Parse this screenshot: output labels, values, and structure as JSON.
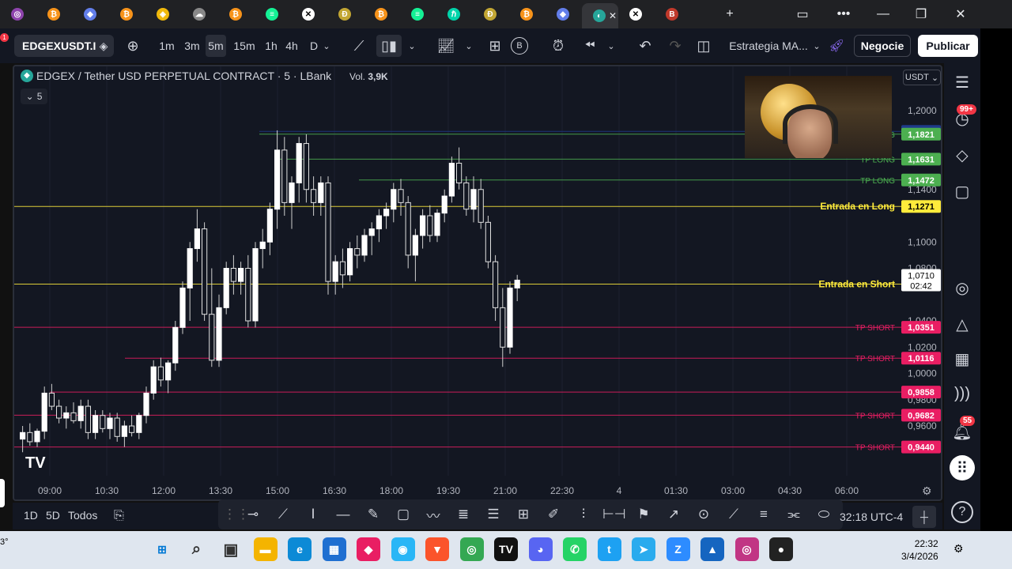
{
  "browser": {
    "tabs": [
      {
        "icon": "circle-icon",
        "color": "#8e44ad",
        "glyph": "◎"
      },
      {
        "icon": "bitcoin-icon",
        "color": "#f7931a",
        "glyph": "₿"
      },
      {
        "icon": "ethereum-icon",
        "color": "#627eea",
        "glyph": "◆"
      },
      {
        "icon": "bitcoin-icon",
        "color": "#f7931a",
        "glyph": "₿"
      },
      {
        "icon": "shield-coin-icon",
        "color": "#f0b90b",
        "glyph": "◈"
      },
      {
        "icon": "cloud-icon",
        "color": "#888888",
        "glyph": "☁"
      },
      {
        "icon": "bitcoin-icon",
        "color": "#f7931a",
        "glyph": "₿"
      },
      {
        "icon": "solana-icon",
        "color": "#14f195",
        "glyph": "≡"
      },
      {
        "icon": "x-icon",
        "color": "#ffffff",
        "glyph": "✕"
      },
      {
        "icon": "dogecoin-icon",
        "color": "#c2a633",
        "glyph": "Ð"
      },
      {
        "icon": "bitcoin-icon",
        "color": "#f7931a",
        "glyph": "₿"
      },
      {
        "icon": "solana-icon",
        "color": "#14f195",
        "glyph": "≡"
      },
      {
        "icon": "hbar-icon",
        "color": "#00d4aa",
        "glyph": "ℏ"
      },
      {
        "icon": "dogecoin-icon",
        "color": "#c2a633",
        "glyph": "Ð"
      },
      {
        "icon": "bitcoin-icon",
        "color": "#f7931a",
        "glyph": "₿"
      },
      {
        "icon": "ethereum-icon",
        "color": "#627eea",
        "glyph": "◆"
      },
      {
        "icon": "tradingview-icon",
        "color": "#26a69a",
        "glyph": "◐",
        "active": true
      },
      {
        "icon": "x-logo-icon",
        "color": "#ffffff",
        "glyph": "✕"
      },
      {
        "icon": "red-app-icon",
        "color": "#c0392b",
        "glyph": "B"
      }
    ]
  },
  "toolbar": {
    "symbol": "EDGEXUSDT.I",
    "intervals": [
      "1m",
      "3m",
      "5m",
      "15m",
      "1h",
      "4h",
      "D"
    ],
    "selected_interval": "5m",
    "strategy": "Estrategia MA...",
    "negocie": "Negocie",
    "publicar": "Publicar",
    "notif_count": "1"
  },
  "legend": {
    "title": "EDGEX / Tether USD PERPETUAL CONTRACT · 5 · LBank",
    "vol_label": "Vol.",
    "vol_value": "3,9K",
    "collapse_count": "5",
    "currency": "USDT"
  },
  "chart_data": {
    "type": "candlestick",
    "price_axis": [
      "1,2000",
      "1,1400",
      "1,1000",
      "1,0800",
      "1,0400",
      "1,0200",
      "1,0000",
      "0,9800",
      "0,9600"
    ],
    "time_axis": [
      "09:00",
      "10:30",
      "12:00",
      "13:30",
      "15:00",
      "16:30",
      "18:00",
      "19:30",
      "21:00",
      "22:30",
      "4",
      "01:30",
      "03:00",
      "04:30",
      "06:00"
    ],
    "levels": [
      {
        "label": "",
        "price": "1,1842",
        "color": "#1e3a8a"
      },
      {
        "label": "TP LONG",
        "price": "1,1821",
        "color": "#4caf50"
      },
      {
        "label": "TP LONG",
        "price": "1,1631",
        "color": "#4caf50"
      },
      {
        "label": "TP LONG",
        "price": "1,1472",
        "color": "#4caf50"
      },
      {
        "label": "Entrada en Long",
        "price": "1,1271",
        "color": "#ffeb3b"
      },
      {
        "label": "Entrada en Short",
        "price": "1,0680",
        "color": "#ffeb3b"
      },
      {
        "label": "TP SHORT",
        "price": "1,0351",
        "color": "#e91e63"
      },
      {
        "label": "TP SHORT",
        "price": "1,0116",
        "color": "#e91e63"
      },
      {
        "label": "",
        "price": "0,9858",
        "color": "#e91e63"
      },
      {
        "label": "TP SHORT",
        "price": "0,9682",
        "color": "#e91e63"
      },
      {
        "label": "TP SHORT",
        "price": "0,9440",
        "color": "#e91e63"
      }
    ],
    "current_price": "1,0710",
    "countdown": "02:42",
    "candles": [
      [
        0.95,
        0.96,
        0.94,
        0.955
      ],
      [
        0.955,
        0.962,
        0.945,
        0.948
      ],
      [
        0.948,
        0.958,
        0.944,
        0.956
      ],
      [
        0.956,
        0.99,
        0.95,
        0.985
      ],
      [
        0.985,
        0.992,
        0.972,
        0.975
      ],
      [
        0.975,
        0.98,
        0.962,
        0.966
      ],
      [
        0.966,
        0.975,
        0.958,
        0.97
      ],
      [
        0.97,
        0.978,
        0.962,
        0.964
      ],
      [
        0.964,
        0.98,
        0.958,
        0.975
      ],
      [
        0.975,
        0.98,
        0.95,
        0.955
      ],
      [
        0.955,
        0.972,
        0.95,
        0.968
      ],
      [
        0.968,
        0.972,
        0.955,
        0.958
      ],
      [
        0.958,
        0.97,
        0.95,
        0.966
      ],
      [
        0.966,
        0.97,
        0.948,
        0.952
      ],
      [
        0.952,
        0.964,
        0.944,
        0.96
      ],
      [
        0.96,
        0.968,
        0.952,
        0.955
      ],
      [
        0.955,
        0.97,
        0.95,
        0.968
      ],
      [
        0.968,
        0.99,
        0.962,
        0.985
      ],
      [
        0.985,
        1.01,
        0.98,
        1.005
      ],
      [
        1.005,
        1.012,
        0.99,
        0.995
      ],
      [
        0.995,
        1.01,
        0.985,
        1.008
      ],
      [
        1.008,
        1.04,
        1.002,
        1.035
      ],
      [
        1.035,
        1.07,
        1.03,
        1.065
      ],
      [
        1.065,
        1.1,
        1.04,
        1.095
      ],
      [
        1.095,
        1.125,
        1.085,
        1.11
      ],
      [
        1.11,
        1.115,
        1.04,
        1.045
      ],
      [
        1.045,
        1.08,
        1.005,
        1.01
      ],
      [
        1.01,
        1.06,
        1.005,
        1.05
      ],
      [
        1.05,
        1.085,
        1.045,
        1.08
      ],
      [
        1.08,
        1.09,
        1.06,
        1.07
      ],
      [
        1.07,
        1.085,
        1.06,
        1.08
      ],
      [
        1.08,
        1.09,
        1.035,
        1.04
      ],
      [
        1.04,
        1.1,
        1.035,
        1.095
      ],
      [
        1.095,
        1.11,
        1.08,
        1.1
      ],
      [
        1.1,
        1.13,
        1.09,
        1.125
      ],
      [
        1.125,
        1.185,
        1.11,
        1.17
      ],
      [
        1.17,
        1.18,
        1.12,
        1.13
      ],
      [
        1.13,
        1.15,
        1.11,
        1.145
      ],
      [
        1.145,
        1.18,
        1.13,
        1.175
      ],
      [
        1.175,
        1.182,
        1.13,
        1.14
      ],
      [
        1.14,
        1.15,
        1.12,
        1.13
      ],
      [
        1.13,
        1.15,
        1.12,
        1.145
      ],
      [
        1.145,
        1.15,
        1.06,
        1.07
      ],
      [
        1.07,
        1.09,
        1.06,
        1.085
      ],
      [
        1.085,
        1.095,
        1.065,
        1.075
      ],
      [
        1.075,
        1.1,
        1.07,
        1.095
      ],
      [
        1.095,
        1.105,
        1.08,
        1.09
      ],
      [
        1.09,
        1.11,
        1.085,
        1.105
      ],
      [
        1.105,
        1.115,
        1.09,
        1.11
      ],
      [
        1.11,
        1.125,
        1.1,
        1.12
      ],
      [
        1.12,
        1.13,
        1.11,
        1.125
      ],
      [
        1.125,
        1.145,
        1.115,
        1.14
      ],
      [
        1.14,
        1.148,
        1.12,
        1.13
      ],
      [
        1.13,
        1.135,
        1.08,
        1.09
      ],
      [
        1.09,
        1.11,
        1.07,
        1.105
      ],
      [
        1.105,
        1.125,
        1.095,
        1.12
      ],
      [
        1.12,
        1.128,
        1.1,
        1.105
      ],
      [
        1.105,
        1.125,
        1.1,
        1.122
      ],
      [
        1.122,
        1.14,
        1.115,
        1.135
      ],
      [
        1.135,
        1.165,
        1.13,
        1.16
      ],
      [
        1.16,
        1.172,
        1.14,
        1.145
      ],
      [
        1.145,
        1.15,
        1.12,
        1.125
      ],
      [
        1.125,
        1.15,
        1.115,
        1.14
      ],
      [
        1.14,
        1.148,
        1.11,
        1.115
      ],
      [
        1.115,
        1.12,
        1.08,
        1.085
      ],
      [
        1.085,
        1.09,
        1.04,
        1.05
      ],
      [
        1.05,
        1.065,
        1.005,
        1.02
      ],
      [
        1.02,
        1.07,
        1.015,
        1.065
      ],
      [
        1.065,
        1.075,
        1.055,
        1.071
      ]
    ]
  },
  "bottom": {
    "ranges": [
      "1D",
      "5D",
      "Todos"
    ],
    "timezone": "32:18 UTC-4"
  },
  "sidebar": {
    "notif_badge": "99+",
    "alerts_badge": "55"
  },
  "taskbar": {
    "time": "22:32",
    "date": "3/4/2026",
    "weather": "3°",
    "apps": [
      {
        "icon": "windows-start-icon",
        "color": "#0078d4",
        "glyph": "⊞"
      },
      {
        "icon": "search-icon",
        "color": "#333333",
        "glyph": "⌕"
      },
      {
        "icon": "task-view-icon",
        "color": "#333333",
        "glyph": "▣"
      },
      {
        "icon": "file-explorer-icon",
        "color": "#f4b400",
        "glyph": "▬"
      },
      {
        "icon": "edge-icon",
        "color": "#0c8ad6",
        "glyph": "e"
      },
      {
        "icon": "store-icon",
        "color": "#1f6fd1",
        "glyph": "▦"
      },
      {
        "icon": "gem-icon",
        "color": "#e91e63",
        "glyph": "◆"
      },
      {
        "icon": "chrome-colorful-icon",
        "color": "#29b6f6",
        "glyph": "◉"
      },
      {
        "icon": "brave-icon",
        "color": "#fb542b",
        "glyph": "▼"
      },
      {
        "icon": "chrome-icon",
        "color": "#34a853",
        "glyph": "◎"
      },
      {
        "icon": "tradingview-icon",
        "color": "#111111",
        "glyph": "TV"
      },
      {
        "icon": "discord-icon",
        "color": "#5865f2",
        "glyph": "◕"
      },
      {
        "icon": "whatsapp-icon",
        "color": "#25d366",
        "glyph": "✆"
      },
      {
        "icon": "twitter-icon",
        "color": "#1da1f2",
        "glyph": "t"
      },
      {
        "icon": "telegram-icon",
        "color": "#2aabee",
        "glyph": "➤"
      },
      {
        "icon": "zoom-icon",
        "color": "#2d8cff",
        "glyph": "Z"
      },
      {
        "icon": "mountain-app-icon",
        "color": "#1565c0",
        "glyph": "▲"
      },
      {
        "icon": "instagram-icon",
        "color": "#c13584",
        "glyph": "◎"
      },
      {
        "icon": "obs-icon",
        "color": "#222222",
        "glyph": "●"
      }
    ]
  }
}
